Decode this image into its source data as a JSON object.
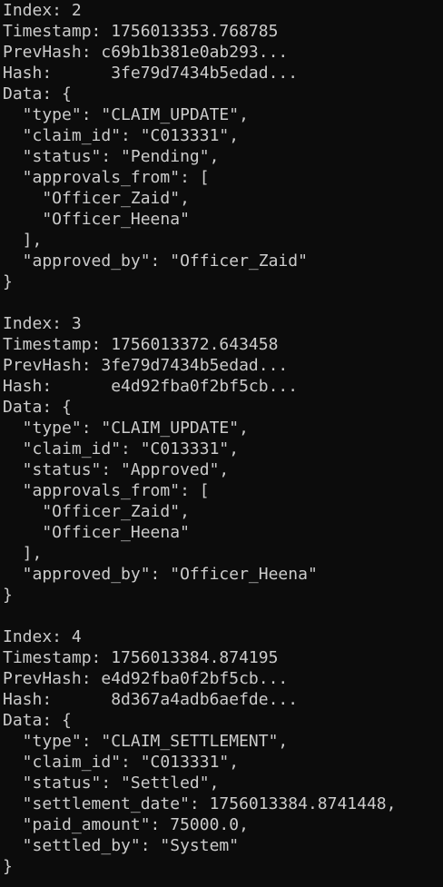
{
  "terminal": {
    "lines": [
      "Index: 2",
      "Timestamp: 1756013353.768785",
      "PrevHash: c69b1b381e0ab293...",
      "Hash:      3fe79d7434b5edad...",
      "Data: {",
      "  \"type\": \"CLAIM_UPDATE\",",
      "  \"claim_id\": \"C013331\",",
      "  \"status\": \"Pending\",",
      "  \"approvals_from\": [",
      "    \"Officer_Zaid\",",
      "    \"Officer_Heena\"",
      "  ],",
      "  \"approved_by\": \"Officer_Zaid\"",
      "}",
      "",
      "Index: 3",
      "Timestamp: 1756013372.643458",
      "PrevHash: 3fe79d7434b5edad...",
      "Hash:      e4d92fba0f2bf5cb...",
      "Data: {",
      "  \"type\": \"CLAIM_UPDATE\",",
      "  \"claim_id\": \"C013331\",",
      "  \"status\": \"Approved\",",
      "  \"approvals_from\": [",
      "    \"Officer_Zaid\",",
      "    \"Officer_Heena\"",
      "  ],",
      "  \"approved_by\": \"Officer_Heena\"",
      "}",
      "",
      "Index: 4",
      "Timestamp: 1756013384.874195",
      "PrevHash: e4d92fba0f2bf5cb...",
      "Hash:      8d367a4adb6aefde...",
      "Data: {",
      "  \"type\": \"CLAIM_SETTLEMENT\",",
      "  \"claim_id\": \"C013331\",",
      "  \"status\": \"Settled\",",
      "  \"settlement_date\": 1756013384.8741448,",
      "  \"paid_amount\": 75000.0,",
      "  \"settled_by\": \"System\"",
      "}"
    ]
  }
}
